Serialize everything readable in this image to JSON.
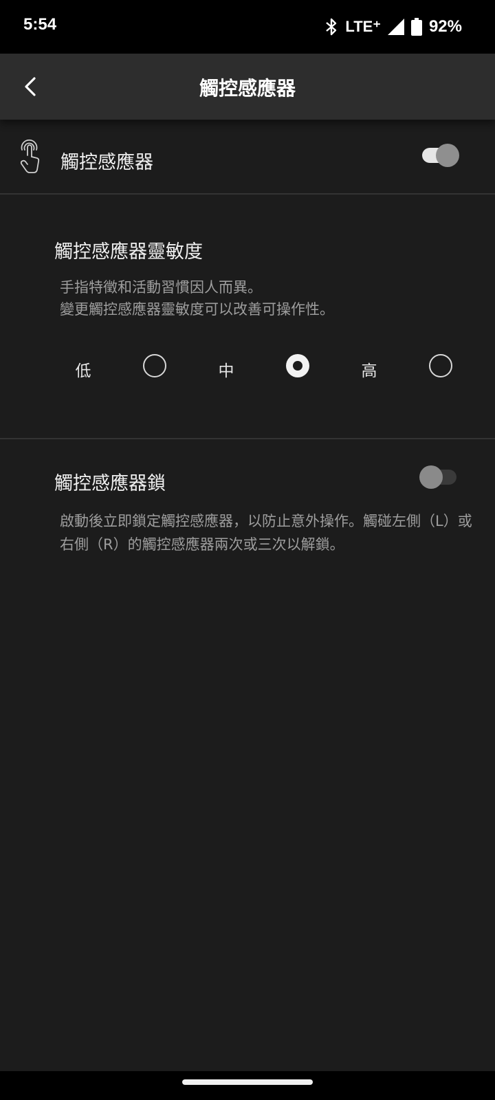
{
  "status_bar": {
    "time": "5:54",
    "network": "LTE⁺",
    "battery": "92%"
  },
  "app_bar": {
    "title": "觸控感應器"
  },
  "touch_sensor": {
    "label": "觸控感應器",
    "enabled": true
  },
  "sensitivity": {
    "title": "觸控感應器靈敏度",
    "description_line1": "手指特徵和活動習慣因人而異。",
    "description_line2": "變更觸控感應器靈敏度可以改善可操作性。",
    "options": [
      {
        "label": "低",
        "selected": false
      },
      {
        "label": "中",
        "selected": true
      },
      {
        "label": "高",
        "selected": false
      }
    ]
  },
  "sensor_lock": {
    "title": "觸控感應器鎖",
    "enabled": false,
    "description": "啟動後立即鎖定觸控感應器，以防止意外操作。觸碰左側（L）或右側（R）的觸控感應器兩次或三次以解鎖。"
  },
  "colors": {
    "background": "#1c1c1c",
    "app_bar": "#2d2d2d",
    "status_bar": "#000000",
    "secondary_text": "#9e9e9e"
  }
}
